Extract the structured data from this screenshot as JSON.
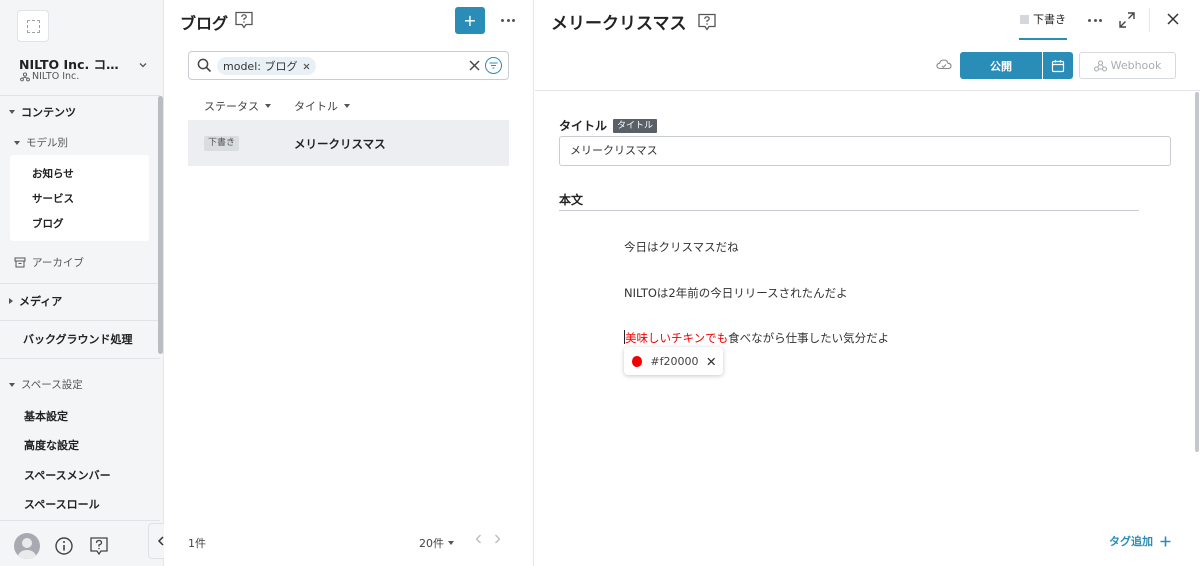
{
  "sidebar": {
    "space_name": "NILTO Inc. コーポ...",
    "org_name": "NILTO Inc.",
    "contents_label": "コンテンツ",
    "by_model_label": "モデル別",
    "models": [
      "お知らせ",
      "サービス",
      "ブログ"
    ],
    "archive_label": "アーカイブ",
    "media_label": "メディア",
    "background_label": "バックグラウンド処理",
    "space_settings_label": "スペース設定",
    "settings_items": [
      "基本設定",
      "高度な設定",
      "スペースメンバー",
      "スペースロール"
    ]
  },
  "list": {
    "title": "ブログ",
    "add_label": "+",
    "search_chip": "model: ブログ",
    "columns": [
      "ステータス",
      "タイトル"
    ],
    "rows": [
      {
        "status": "下書き",
        "title": "メリークリスマス"
      }
    ],
    "count": "1件",
    "per_page": "20件"
  },
  "editor": {
    "title": "メリークリスマス",
    "status_tab": "下書き",
    "publish_label": "公開",
    "webhook_label": "Webhook",
    "title_field_label": "タイトル",
    "title_field_tag": "タイトル",
    "title_value": "メリークリスマス",
    "body_label": "本文",
    "paragraphs": [
      "今日はクリスマスだね",
      "NILTOは2年前の今日リリースされたんだよ"
    ],
    "para3_red": "美味しいチキンでも",
    "para3_rest": "食べながら仕事したい気分だよ",
    "color_value": "#f20000",
    "tag_add_label": "タグ追加"
  },
  "colors": {
    "accent": "#2a8db8",
    "highlight": "#f20000"
  }
}
